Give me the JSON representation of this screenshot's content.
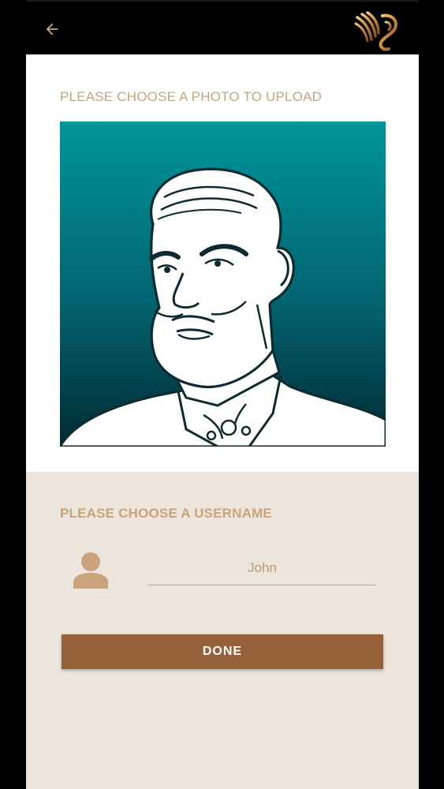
{
  "header": {
    "back_icon": "arrow-left-icon",
    "logo_icon": "brand-logo-icon",
    "colors": {
      "background": "#000000",
      "icon": "#c9a47a"
    }
  },
  "photo_section": {
    "label": "PLEASE CHOOSE A PHOTO TO UPLOAD",
    "image_icon": "bearded-man-portrait-illustration",
    "colors": {
      "gradient_top": "#00959a",
      "gradient_bottom": "#012a34"
    }
  },
  "username_section": {
    "label": "PLEASE CHOOSE A USERNAME",
    "user_icon": "person-icon",
    "input_value": "John"
  },
  "done_button": {
    "label": "DONE",
    "color": "#96603a"
  },
  "colors": {
    "accent": "#c9a47a",
    "form_background": "#ebe5db"
  }
}
